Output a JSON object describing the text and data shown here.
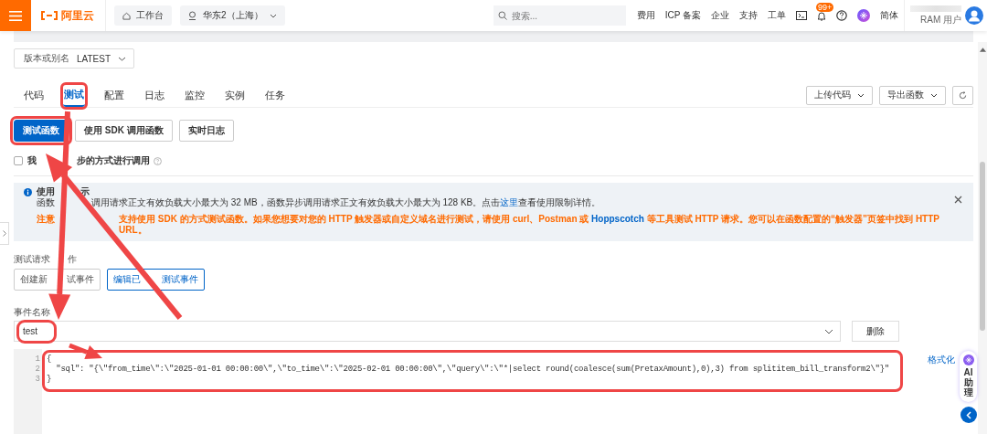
{
  "header": {
    "logo": "阿里云",
    "workbench": "工作台",
    "region": "华东2（上海）",
    "search": {
      "placeholder": "搜索..."
    },
    "nav": [
      "费用",
      "ICP 备案",
      "企业",
      "支持",
      "工单"
    ],
    "notifications_badge": "99+",
    "language": "简体",
    "user_role": "RAM 用户"
  },
  "version_select": {
    "label": "版本或别名",
    "value": "LATEST"
  },
  "tabs": [
    {
      "label": "代码",
      "selected": false,
      "highlighted": false
    },
    {
      "label": "测试",
      "selected": true,
      "highlighted": true
    },
    {
      "label": "配置",
      "selected": false,
      "highlighted": false
    },
    {
      "label": "日志",
      "selected": false,
      "highlighted": false
    },
    {
      "label": "监控",
      "selected": false,
      "highlighted": false
    },
    {
      "label": "实例",
      "selected": false,
      "highlighted": false
    },
    {
      "label": "任务",
      "selected": false,
      "highlighted": false
    }
  ],
  "tab_actions": [
    "上传代码",
    "导出函数"
  ],
  "test_buttons": [
    {
      "label": "测试函数",
      "primary": true,
      "highlighted": true
    },
    {
      "label": "使用 SDK 调用函数",
      "primary": false,
      "highlighted": false
    },
    {
      "label": "实时日志",
      "primary": false,
      "highlighted": false
    }
  ],
  "async_option": {
    "label_parts": [
      "我",
      "步的方式进行调用"
    ],
    "checked": false
  },
  "notice": {
    "title_parts": [
      "使用",
      "示"
    ],
    "limits": {
      "lead": "函数",
      "before": "调用请求正文有效负载大小最大为 32 MB，函数异步调用请求正文有效负载大小最大为 128 KB。点击",
      "link": "这里",
      "after": "查看使用限制详情。"
    },
    "warning": {
      "lead": "注意",
      "before": "支持使用 SDK 的方式测试函数。如果您想要对您的 HTTP 触发器或自定义域名进行测试，请使用 curl、Postman 或 ",
      "link": "Hoppscotch",
      "after": " 等工具测试 HTTP 请求。您可以在函数配置的“触发器”页签中找到 HTTP URL。"
    }
  },
  "event_actions": {
    "label_parts": [
      "测试请求",
      "作"
    ],
    "buttons": [
      {
        "label_parts": [
          "创建新",
          "试事件"
        ],
        "selected": false
      },
      {
        "label_parts": [
          "编辑已",
          "测试事件"
        ],
        "selected": true
      }
    ]
  },
  "event_name": {
    "label": "事件名称",
    "value": "test",
    "highlighted": true
  },
  "delete_button": "删除",
  "editor": {
    "highlighted": true,
    "format_link": "格式化",
    "lines": [
      {
        "number": "1",
        "text": "{"
      },
      {
        "number": "2",
        "text": "  \"sql\": \"{\\\"from_time\\\":\\\"2025-01-01 00:00:00\\\",\\\"to_time\\\":\\\"2025-02-01 00:00:00\\\",\\\"query\\\":\\\"*|select round(coalesce(sum(PretaxAmount),0),3) from splititem_bill_transform2\\\"}\""
      },
      {
        "number": "3",
        "text": "}"
      }
    ]
  },
  "ai_assistant": {
    "label": "AI助理"
  }
}
